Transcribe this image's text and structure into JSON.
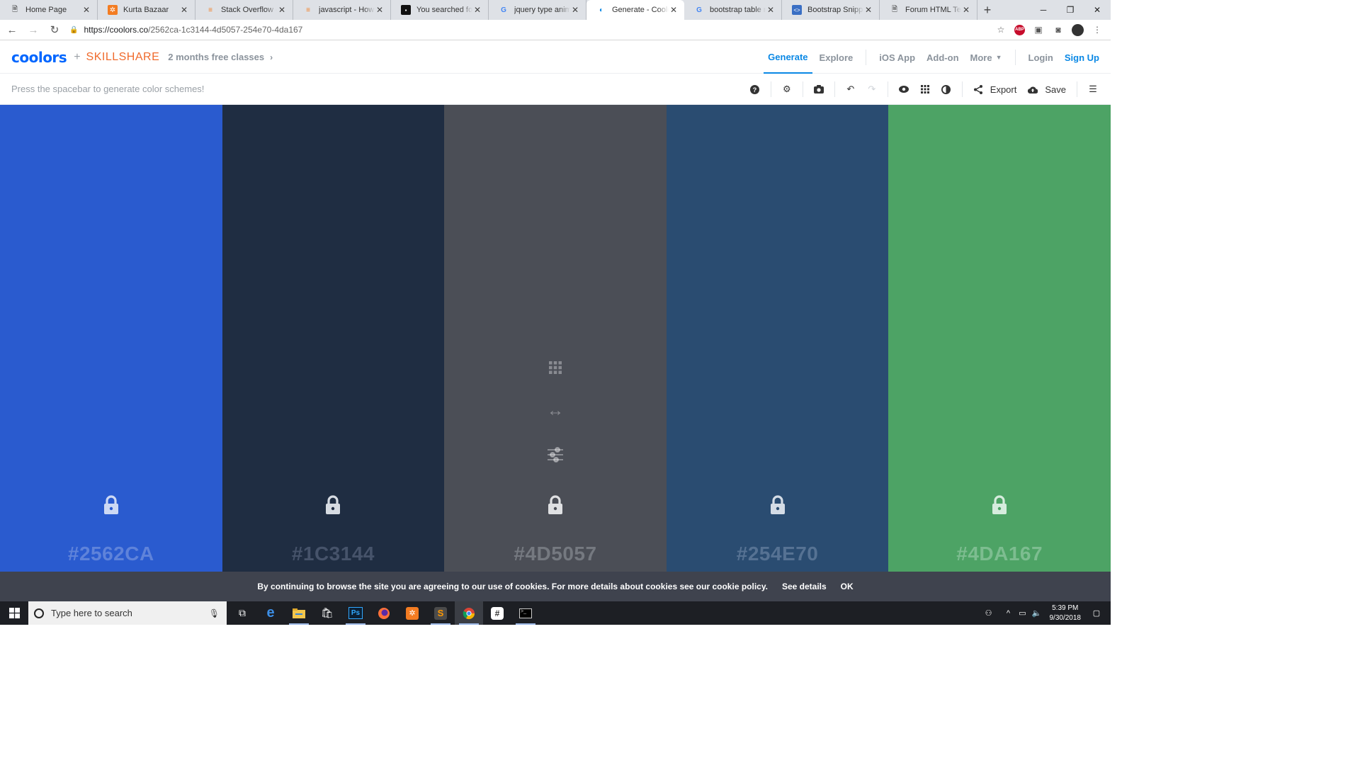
{
  "browser": {
    "tabs": [
      {
        "title": "Home Page",
        "icon": "page-icon",
        "active": false
      },
      {
        "title": "Kurta Bazaar",
        "icon": "xampp-icon",
        "active": false
      },
      {
        "title": "Stack Overflow - Wi",
        "icon": "stackoverflow-icon",
        "active": false
      },
      {
        "title": "javascript - How to",
        "icon": "stackoverflow-icon",
        "active": false
      },
      {
        "title": "You searched for re",
        "icon": "site-icon",
        "active": false
      },
      {
        "title": "jquery type animati",
        "icon": "google-icon",
        "active": false
      },
      {
        "title": "Generate - Coolors",
        "icon": "coolors-icon",
        "active": true
      },
      {
        "title": "bootstrap table resp",
        "icon": "google-icon",
        "active": false
      },
      {
        "title": "Bootstrap Snippet f",
        "icon": "snippet-icon",
        "active": false
      },
      {
        "title": "Forum HTML Temp",
        "icon": "page-icon",
        "active": false
      }
    ],
    "url_host": "https://coolors.co",
    "url_path": "/2562ca-1c3144-4d5057-254e70-4da167"
  },
  "header": {
    "logo": "coolors",
    "plus": "+",
    "partner": "SKILLSHARE",
    "promo": "2 months free classes",
    "nav": {
      "generate": "Generate",
      "explore": "Explore",
      "ios": "iOS App",
      "addon": "Add-on",
      "more": "More",
      "login": "Login",
      "signup": "Sign Up"
    }
  },
  "toolbar": {
    "hint": "Press the spacebar to generate color schemes!",
    "export": "Export",
    "save": "Save"
  },
  "palette": [
    {
      "hex": "#2562CA",
      "color": "#2a5bcf",
      "text_color": "#5f83da",
      "lock_color": "#cdd9f4"
    },
    {
      "hex": "#1C3144",
      "color": "#1f2d42",
      "text_color": "#46536a",
      "lock_color": "#d6dbe2"
    },
    {
      "hex": "#4D5057",
      "color": "#4b4e56",
      "text_color": "#757980",
      "lock_color": "#dfe0e2"
    },
    {
      "hex": "#254E70",
      "color": "#2a4c71",
      "text_color": "#567293",
      "lock_color": "#d4dce6"
    },
    {
      "hex": "#4DA167",
      "color": "#4da365",
      "text_color": "#7dbd90",
      "lock_color": "#d6ecdd"
    }
  ],
  "cookie": {
    "text": "By continuing to browse the site you are agreeing to our use of cookies. For more details about cookies see our cookie policy.",
    "see_details": "See details",
    "ok": "OK"
  },
  "taskbar": {
    "search_placeholder": "Type here to search",
    "time": "5:39 PM",
    "date": "9/30/2018"
  }
}
